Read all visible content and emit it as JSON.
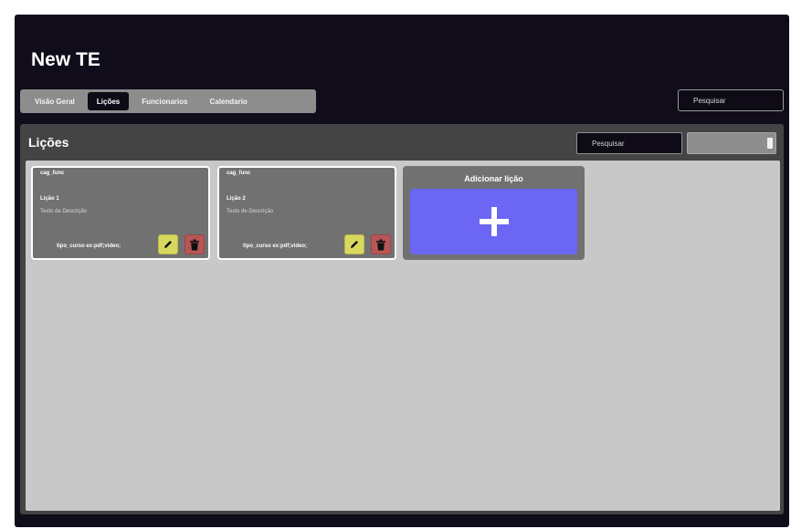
{
  "app": {
    "title": "New TE"
  },
  "tabs": [
    {
      "label": "Visão Geral",
      "active": false
    },
    {
      "label": "Lições",
      "active": true
    },
    {
      "label": "Funcionarios",
      "active": false
    },
    {
      "label": "Calendario",
      "active": false
    }
  ],
  "top_search": {
    "label": "Pesquisar"
  },
  "panel": {
    "title": "Lições",
    "search_label": "Pesquisar",
    "select_value": ""
  },
  "cards": [
    {
      "category": "cag_func",
      "name": "Lição 1",
      "description": "Texto de Descrição",
      "types": "tipo_curso ex:pdf;video;"
    },
    {
      "category": "cag_func",
      "name": "Lição 2",
      "description": "Texto de Descrição",
      "types": "tipo_curso ex:pdf;video;"
    }
  ],
  "add_card": {
    "title": "Adicionar lição"
  },
  "colors": {
    "background": "#110c1a",
    "panel": "#444444",
    "content": "#c8c8c8",
    "card": "#717171",
    "edit_button": "#d8d85e",
    "delete_button": "#b85656",
    "add_button": "#6b66f4"
  },
  "icons": {
    "edit": "pencil-icon",
    "delete": "trash-icon",
    "add": "plus-icon"
  }
}
